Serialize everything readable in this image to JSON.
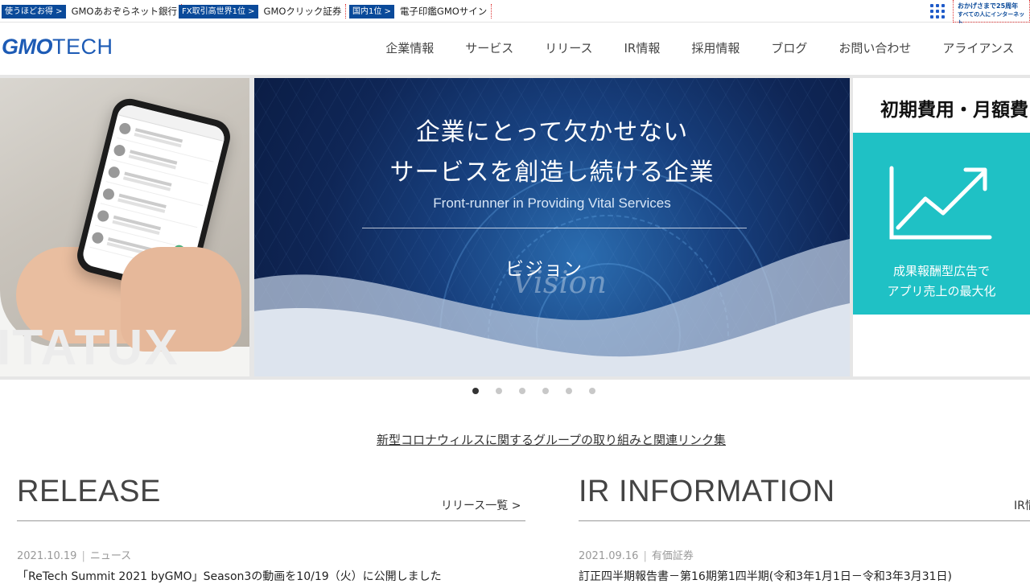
{
  "promos": [
    {
      "tag": "使うほどお得 >",
      "text": "GMOあおぞらネット銀行"
    },
    {
      "tag": "FX取引高世界1位 >",
      "text": "GMOクリック証券"
    },
    {
      "tag": "国内1位 >",
      "text": "電子印鑑GMOサイン"
    }
  ],
  "anniversary": {
    "line1": "おかげさまで25周年",
    "line2": "すべての人にインターネット"
  },
  "logo": {
    "part1": "GMO",
    "part2": "TECH"
  },
  "nav": [
    "企業情報",
    "サービス",
    "リリース",
    "IR情報",
    "採用情報",
    "ブログ",
    "お問い合わせ",
    "アライアンス"
  ],
  "hero": {
    "left_ghost": "ITATUX",
    "main": {
      "line1": "企業にとって欠かせない",
      "line2": "サービスを創造し続ける企業",
      "sub": "Front-runner in Providing Vital Services",
      "vision_jp": "ビジョン",
      "vision_en": "Vision"
    },
    "right": {
      "title": "初期費用・月額費",
      "caption1": "成果報酬型広告で",
      "caption2": "アプリ売上の最大化"
    },
    "dots_total": 6,
    "dots_active": 1
  },
  "covid_link": "新型コロナウィルスに関するグループの取り組みと関連リンク集",
  "release": {
    "title": "RELEASE",
    "more": "リリース一覧 >",
    "date": "2021.10.19",
    "category": "ニュース",
    "headline": "「ReTech Summit 2021 byGMO」Season3の動画を10/19（火）に公開しました"
  },
  "ir": {
    "title": "IR INFORMATION",
    "more": "IR情",
    "date": "2021.09.16",
    "category": "有価証券",
    "headline": "訂正四半期報告書－第16期第1四半期(令和3年1月1日－令和3年3月31日)"
  },
  "colors": {
    "brand": "#1d5bb5",
    "promo_tag": "#0a4a9a",
    "teal": "#1fc1c5",
    "hero_navy": "#0f2656"
  }
}
